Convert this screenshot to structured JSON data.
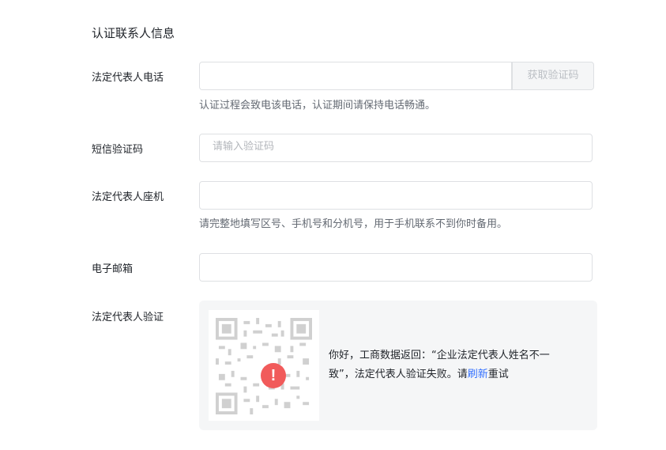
{
  "section_title": "认证联系人信息",
  "fields": {
    "phone": {
      "label": "法定代表人电话",
      "value": "",
      "get_code_label": "获取验证码",
      "hint": "认证过程会致电该电话，认证期间请保持电话畅通。"
    },
    "sms_code": {
      "label": "短信验证码",
      "placeholder": "请输入验证码"
    },
    "landline": {
      "label": "法定代表人座机",
      "value": "",
      "hint": "请完整地填写区号、手机号和分机号，用于手机联系不到你时备用。"
    },
    "email": {
      "label": "电子邮箱",
      "value": ""
    },
    "verification": {
      "label": "法定代表人验证",
      "error_icon": "exclamation-circle-icon",
      "message_prefix": "你好，工商数据返回：“企业法定代表人姓名不一致”，法定代表人验证失败。请",
      "refresh_link": "刷新",
      "message_suffix": "重试"
    }
  },
  "colors": {
    "accent": "#3370ff",
    "error": "#f15b5b",
    "panel_bg": "#f5f6f7"
  }
}
